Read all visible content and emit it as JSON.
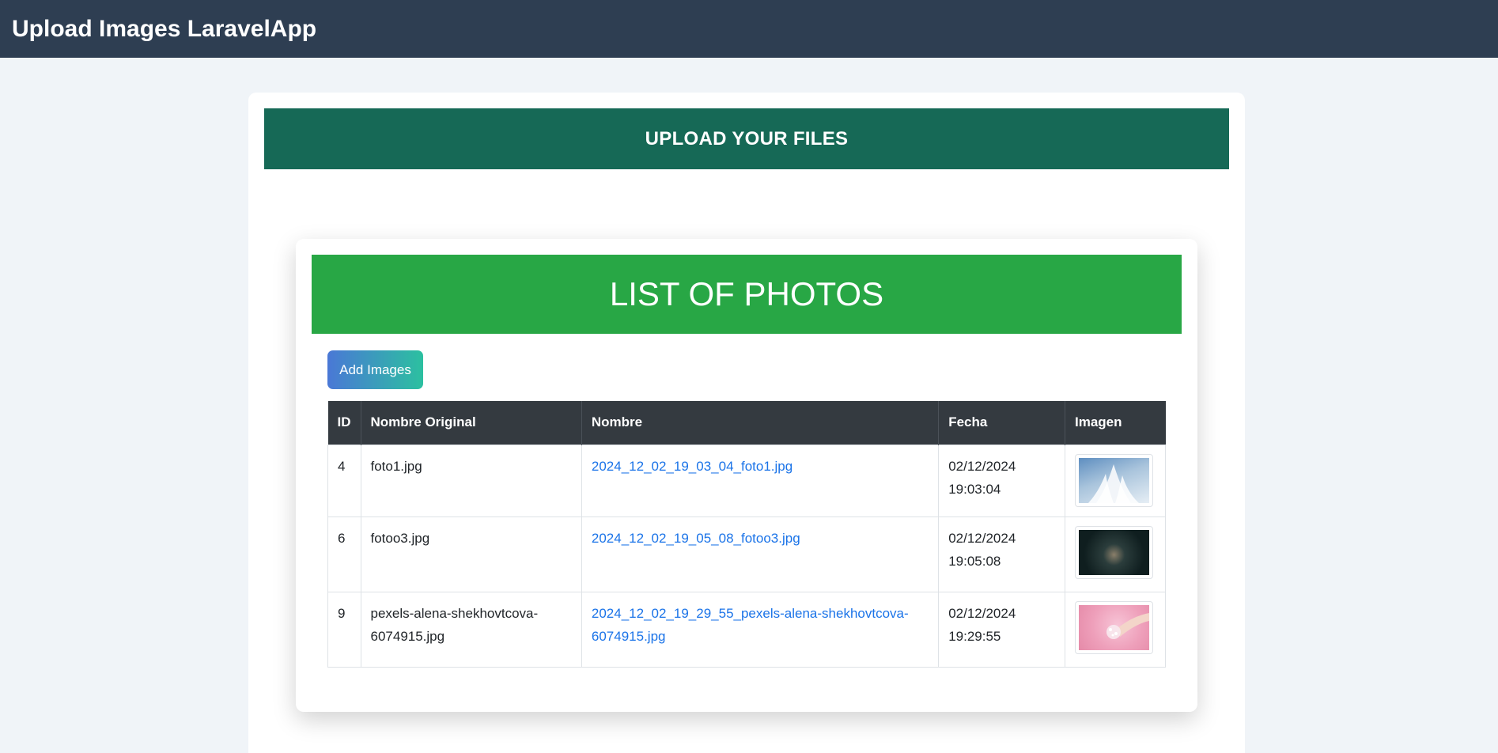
{
  "app": {
    "title": "Upload Images LaravelApp"
  },
  "upload": {
    "heading": "UPLOAD YOUR FILES"
  },
  "photos": {
    "heading": "LIST OF PHOTOS",
    "add_button": "Add Images",
    "columns": [
      "ID",
      "Nombre Original",
      "Nombre",
      "Fecha",
      "Imagen"
    ],
    "rows": [
      {
        "id": "4",
        "original": "foto1.jpg",
        "name": "2024_12_02_19_03_04_foto1.jpg",
        "date": "02/12/2024",
        "time": "19:03:04",
        "thumb_icon": "image-thumbnail-icon"
      },
      {
        "id": "6",
        "original": "fotoo3.jpg",
        "name": "2024_12_02_19_05_08_fotoo3.jpg",
        "date": "02/12/2024",
        "time": "19:05:08",
        "thumb_icon": "image-thumbnail-icon"
      },
      {
        "id": "9",
        "original_line1": "pexels-alena-shekhovtcova-",
        "original_line2": "6074915.jpg",
        "name_line1": "2024_12_02_19_29_55_pexels-alena-shekhovtcova-",
        "name_line2": "6074915.jpg",
        "date": "02/12/2024",
        "time": "19:29:55",
        "thumb_icon": "image-thumbnail-icon"
      }
    ]
  },
  "colors": {
    "topbar": "#2e3e52",
    "upload_header": "#166956",
    "list_header": "#28a745",
    "table_header": "#343a40",
    "link": "#1a73e8"
  }
}
